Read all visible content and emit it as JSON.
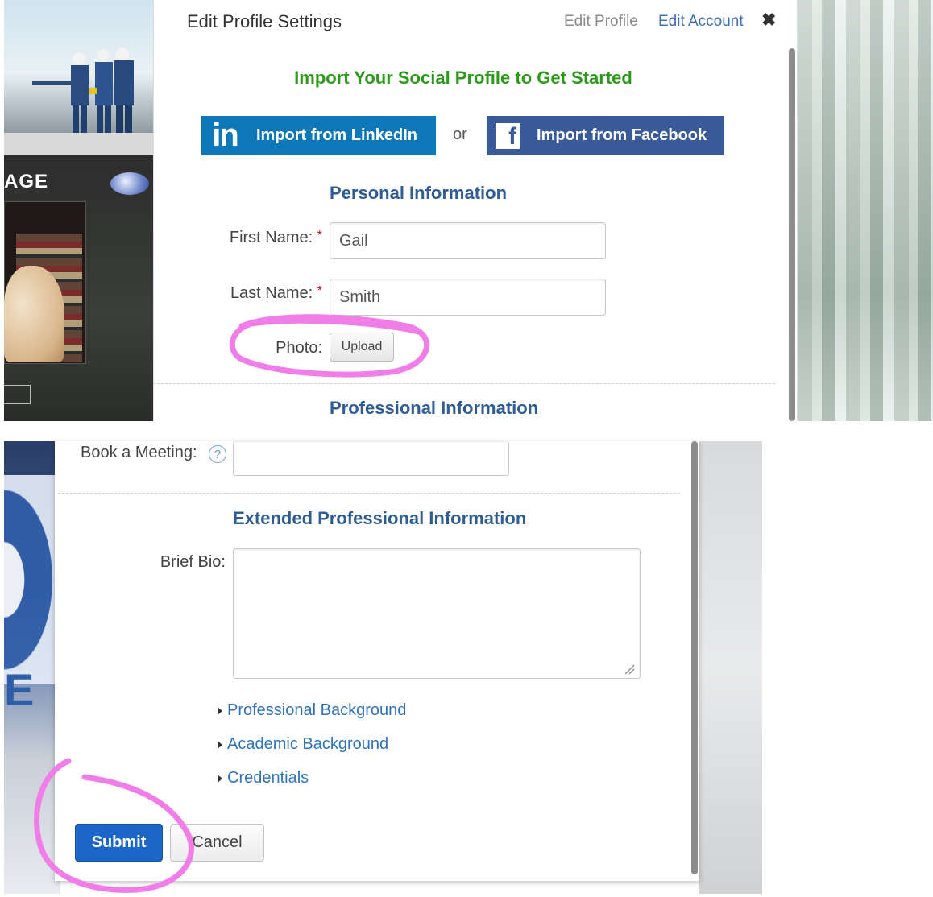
{
  "modal": {
    "title": "Edit Profile Settings",
    "tabs": [
      "Edit Profile",
      "Edit Account"
    ],
    "close_symbol": "✖"
  },
  "social_import": {
    "heading": "Import Your Social Profile to Get Started",
    "linkedin_logo": "in",
    "linkedin_label": "Import from LinkedIn",
    "or": "or",
    "facebook_logo": "f",
    "facebook_label": "Import from Facebook"
  },
  "personal": {
    "heading": "Personal Information",
    "first_name_label": "First Name:",
    "first_name_value": "Gail",
    "last_name_label": "Last Name:",
    "last_name_value": "Smith",
    "required_mark": "*",
    "photo_label": "Photo:",
    "upload_label": "Upload"
  },
  "professional": {
    "heading": "Professional Information",
    "meeting_label": "Book a Meeting:",
    "help_symbol": "?"
  },
  "extended": {
    "heading": "Extended Professional Information",
    "bio_label": "Brief Bio:",
    "bio_value": "",
    "sections": [
      "Professional Background",
      "Academic Background",
      "Credentials"
    ]
  },
  "actions": {
    "submit_label": "Submit",
    "cancel_label": "Cancel"
  },
  "background": {
    "left_banner_text": "AGE",
    "lower_banner_text": "E"
  },
  "colors": {
    "import_heading": "#2e9a1c",
    "section_heading": "#2f5d93",
    "link": "#2f73c0",
    "linkedin": "#0e77b7",
    "facebook": "#3b5a9a",
    "submit": "#1c66c9",
    "annotation": "#f07de8"
  }
}
